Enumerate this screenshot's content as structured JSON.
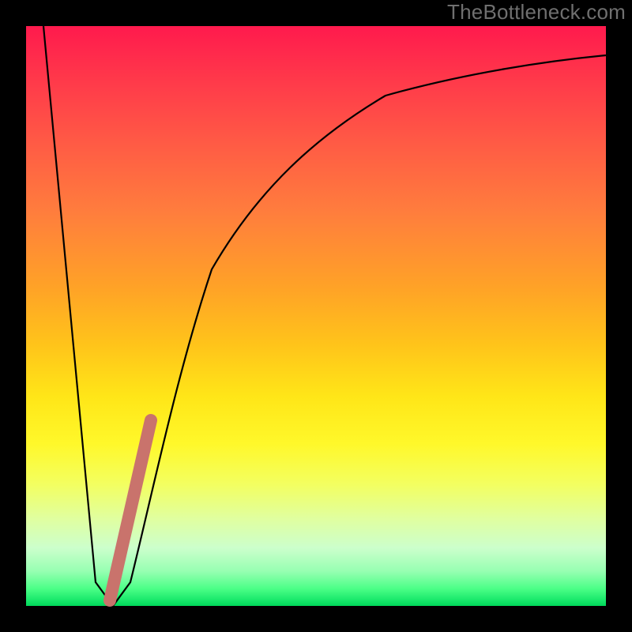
{
  "attribution": {
    "text": "TheBottleneck.com"
  },
  "colors": {
    "frame": "#000000",
    "curve": "#000000",
    "marker": "#c9736c",
    "watermark": "#6f6f6f"
  },
  "chart_data": {
    "type": "line",
    "title": "",
    "xlabel": "",
    "ylabel": "",
    "xlim": [
      0,
      100
    ],
    "ylim": [
      0,
      100
    ],
    "grid": false,
    "legend": false,
    "series": [
      {
        "name": "bottleneck-curve",
        "x": [
          3,
          12,
          15,
          18,
          22,
          26,
          32,
          40,
          50,
          62,
          76,
          90,
          100
        ],
        "y": [
          100,
          4,
          0,
          4,
          20,
          40,
          58,
          72,
          81,
          88,
          92,
          94,
          95
        ]
      },
      {
        "name": "highlight-segment",
        "x": [
          14.5,
          21.5
        ],
        "y": [
          1,
          32
        ]
      }
    ]
  }
}
